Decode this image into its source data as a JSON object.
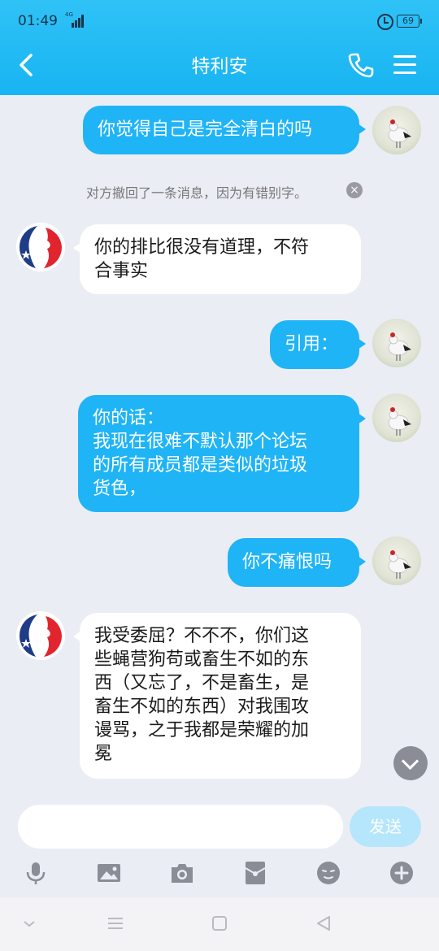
{
  "status_bar": {
    "time": "01:49",
    "network": "4G",
    "battery": "69"
  },
  "header": {
    "title": "特利安"
  },
  "recall_notice": "对方撤回了一条消息，因为有错别字。",
  "messages": [
    {
      "side": "out",
      "text": "你觉得自己是完全清白的吗"
    },
    {
      "side": "in",
      "text": "你的排比很没有道理，不符\n合事实"
    },
    {
      "side": "out",
      "text": "引用："
    },
    {
      "side": "out",
      "text": "你的话：\n我现在很难不默认那个论坛\n的所有成员都是类似的垃圾\n货色，"
    },
    {
      "side": "out",
      "text": "你不痛恨吗"
    },
    {
      "side": "in",
      "text": "我受委屈？不不不，你们这\n些蝇营狗苟或畜生不如的东\n西（又忘了，不是畜生，是\n畜生不如的东西）对我围攻\n谩骂，之于我都是荣耀的加\n冕"
    }
  ],
  "input": {
    "value": "",
    "send_label": "发送"
  },
  "toolbar_icons": [
    "microphone-icon",
    "image-icon",
    "camera-icon",
    "red-packet-icon",
    "emoji-icon",
    "plus-icon"
  ],
  "nav_icons": [
    "chevron-down-icon",
    "menu-icon",
    "home-square-icon",
    "back-triangle-icon"
  ],
  "colors": {
    "header": "#1fb4f5",
    "out_bubble": "#1fb4f5",
    "in_bubble": "#ffffff",
    "background": "#ebedf5"
  }
}
